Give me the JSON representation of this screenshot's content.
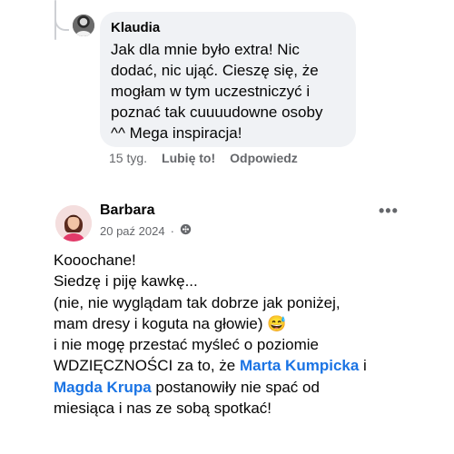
{
  "comment": {
    "author": "Klaudia",
    "lines": [
      "Jak dla mnie było extra! Nic",
      "dodać, nic ująć. Cieszę się, że",
      "mogłam w tym uczestniczyć i",
      "poznać tak cuuuudowne osoby",
      "^^ Mega inspiracja!"
    ],
    "time": "15 tyg.",
    "like_label": "Lubię to!",
    "reply_label": "Odpowiedz"
  },
  "post": {
    "author": "Barbara",
    "date": "20 paź 2024",
    "dot": "·",
    "more": "•••",
    "line1": "Kooochane!",
    "line2": "Siedzę i piję kawkę...",
    "line3": "(nie, nie wyglądam tak dobrze jak poniżej,",
    "line4": "mam dresy i koguta na głowie)",
    "emoji": "😅",
    "line5": "i nie mogę przestać myśleć o poziomie",
    "line6_before": "WDZIĘCZNOŚCI za to, że ",
    "mention1": "Marta Kumpicka",
    "line6_after": " i",
    "mention2": "Magda Krupa",
    "line7_after": " postanowiły nie spać od",
    "line8": "miesiąca i nas ze sobą spotkać!"
  },
  "colors": {
    "bubble": "#f0f2f5",
    "secondary_text": "#65676b",
    "mention": "#1b74e4"
  },
  "icons": {
    "privacy": "globe-icon",
    "more": "more-options-icon"
  }
}
